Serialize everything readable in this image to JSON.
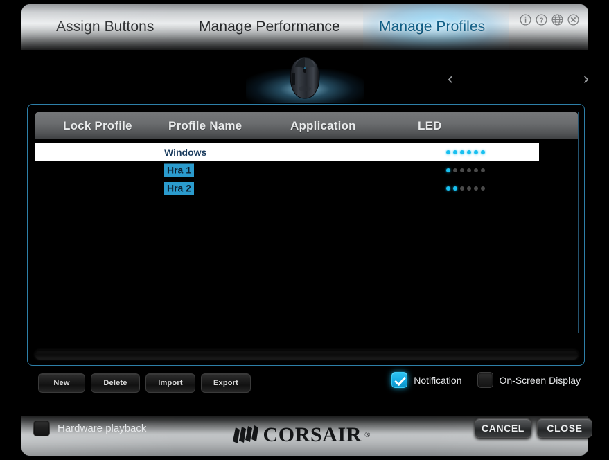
{
  "window": {
    "tabs": [
      {
        "label": "Assign Buttons",
        "active": false
      },
      {
        "label": "Manage Performance",
        "active": false
      },
      {
        "label": "Manage Profiles",
        "active": true
      }
    ],
    "title_icons": [
      {
        "name": "info-icon",
        "glyph": "i"
      },
      {
        "name": "help-icon",
        "glyph": "?"
      },
      {
        "name": "language-globe-icon",
        "glyph": "globe"
      },
      {
        "name": "close-icon",
        "glyph": "x"
      }
    ],
    "brand": {
      "name": "CORSAIR",
      "registered": "®"
    }
  },
  "device_selector": {
    "prev_label": "‹",
    "next_label": "›",
    "device_name": "gaming-mouse"
  },
  "profiles_table": {
    "columns": [
      "Lock Profile",
      "Profile Name",
      "Application",
      "LED"
    ],
    "rows": [
      {
        "lock": "",
        "name": "Windows",
        "application": "",
        "leds": [
          1,
          1,
          1,
          1,
          1,
          1
        ],
        "selected": true,
        "name_highlighted": false
      },
      {
        "lock": "",
        "name": "Hra 1",
        "application": "",
        "leds": [
          1,
          0,
          0,
          0,
          0,
          0
        ],
        "selected": false,
        "name_highlighted": true
      },
      {
        "lock": "",
        "name": "Hra 2",
        "application": "",
        "leds": [
          1,
          1,
          0,
          0,
          0,
          0
        ],
        "selected": false,
        "name_highlighted": true
      }
    ]
  },
  "actions": {
    "new": "New",
    "delete": "Delete",
    "import": "Import",
    "export": "Export"
  },
  "options": {
    "notification": {
      "label": "Notification",
      "checked": true
    },
    "on_screen_display": {
      "label": "On-Screen Display",
      "checked": false
    },
    "hardware_playback": {
      "label": "Hardware playback",
      "checked": false
    }
  },
  "footer_buttons": {
    "cancel": "CANCEL",
    "close": "CLOSE"
  },
  "colors": {
    "accent_cyan": "#18c0f0",
    "panel_border": "#2d7fa8",
    "highlight_bg": "#2b9bcd",
    "selected_row_bg": "#ffffff",
    "selected_text": "#1b3c5e"
  }
}
